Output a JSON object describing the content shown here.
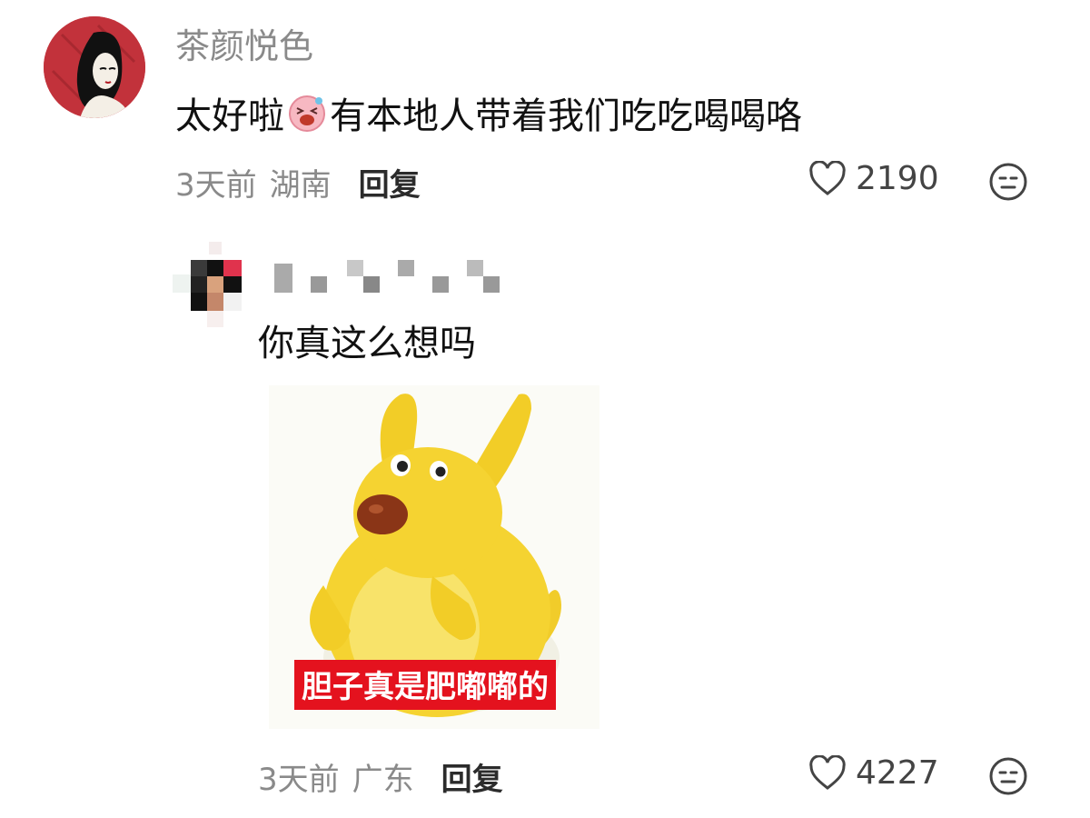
{
  "comments": [
    {
      "username": "茶颜悦色",
      "text_before_emoji": "太好啦",
      "emoji": "pig-laughing-emoji",
      "text_after_emoji": "有本地人带着我们吃吃喝喝咯",
      "time": "3天前",
      "location": "湖南",
      "reply_label": "回复",
      "likes": "2190",
      "react_icon": "neutral-face-icon"
    },
    {
      "username": "",
      "text": "你真这么想吗",
      "sticker_caption": "胆子真是肥嘟嘟的",
      "time": "3天前",
      "location": "广东",
      "reply_label": "回复",
      "likes": "4227",
      "react_icon": "neutral-face-icon"
    }
  ],
  "colors": {
    "avatar_bg": "#c2323b",
    "caption_bg": "#e4121e",
    "meta_text": "#8a8a8a"
  }
}
